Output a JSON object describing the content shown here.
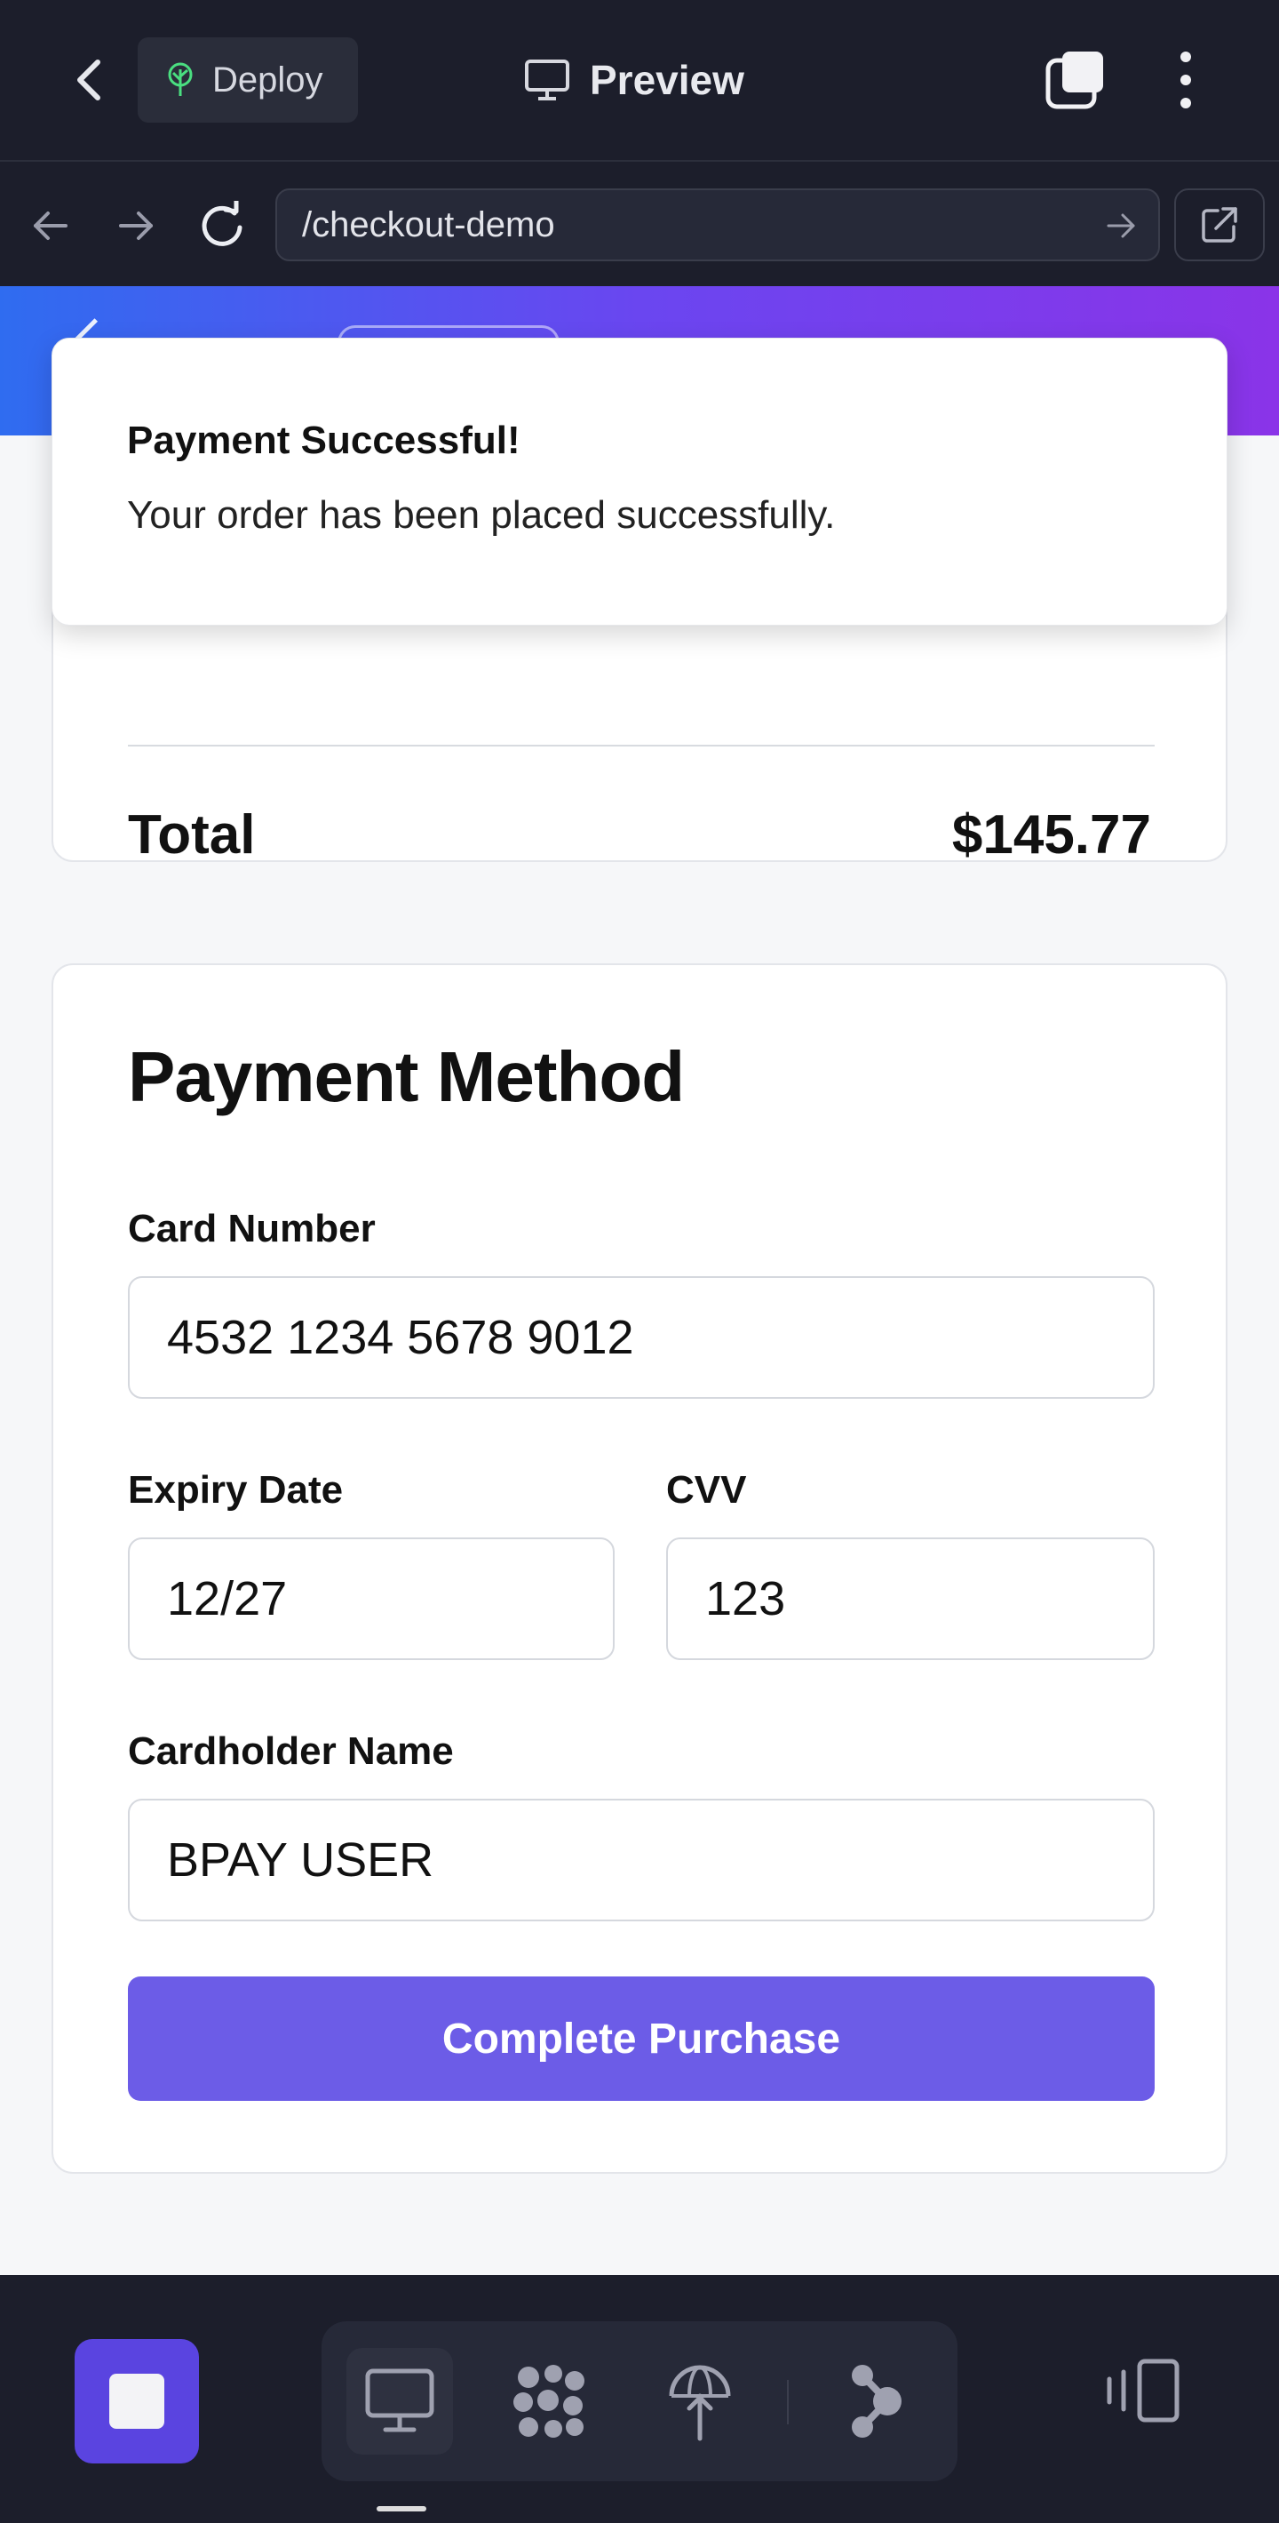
{
  "topbar": {
    "deploy_label": "Deploy",
    "preview_label": "Preview"
  },
  "browser": {
    "url": "/checkout-demo"
  },
  "toast": {
    "title": "Payment Successful!",
    "message": "Your order has been placed successfully."
  },
  "summary": {
    "total_label": "Total",
    "total_value": "$145.77"
  },
  "payment": {
    "title": "Payment Method",
    "card_number_label": "Card Number",
    "card_number_value": "4532 1234 5678 9012",
    "expiry_label": "Expiry Date",
    "expiry_value": "12/27",
    "cvv_label": "CVV",
    "cvv_value": "123",
    "cardholder_label": "Cardholder Name",
    "cardholder_value": "BPAY USER",
    "submit_label": "Complete Purchase"
  },
  "colors": {
    "app_bg": "#1c1e2b",
    "accent": "#6c5ce7",
    "stop_button": "#5a44e0",
    "deploy_icon": "#4ade80"
  },
  "icons": {
    "back": "chevron-left-icon",
    "deploy": "tree-icon",
    "preview": "monitor-icon",
    "tabs": "tabs-icon",
    "more": "more-vertical-icon",
    "nav_back": "arrow-left-icon",
    "nav_forward": "arrow-right-icon",
    "reload": "reload-icon",
    "open_external": "external-link-icon",
    "tools": [
      "monitor-icon",
      "agents-icon",
      "deploy-globe-icon",
      "share-icon"
    ],
    "devices": "devices-icon"
  }
}
